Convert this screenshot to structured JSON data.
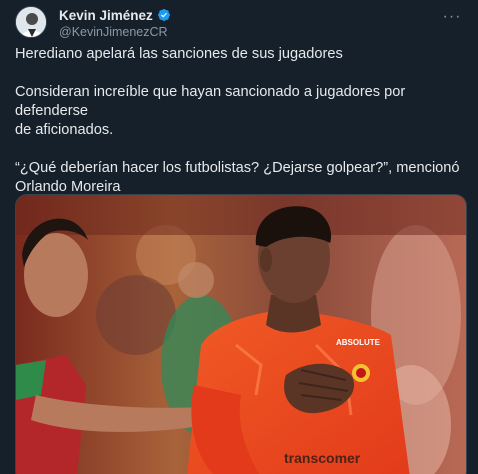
{
  "author": {
    "display_name": "Kevin Jiménez",
    "handle": "@KevinJimenezCR",
    "verified": true,
    "avatar_icon": "user-avatar-icon",
    "verified_icon": "verified-badge-icon"
  },
  "menu": {
    "icon": "more-horizontal-icon",
    "label": "···"
  },
  "tweet": {
    "paragraph1": "Herediano apelará las sanciones de sus jugadores",
    "paragraph2_line1": "Consideran increíble que hayan sancionado a jugadores por defenderse",
    "paragraph2_line2": "de aficionados.",
    "paragraph3_line1": "“¿Qué deberían hacer los futbolistas? ¿Dejarse golpear?”, mencionó",
    "paragraph3_line2": "Orlando Moreira"
  },
  "media": {
    "jersey_sponsor": "transcomer",
    "jersey_brand": "ABSOLUTE"
  },
  "colors": {
    "background": "#15202b",
    "text": "#e7e9ea",
    "muted": "#8b98a5",
    "verified": "#1d9bf0",
    "border": "#38444d"
  }
}
